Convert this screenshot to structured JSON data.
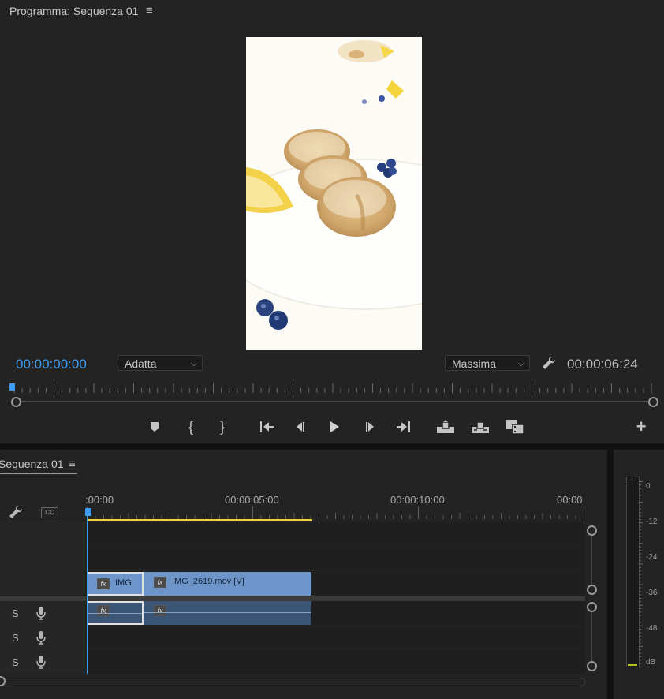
{
  "program": {
    "title": "Programma: Sequenza 01",
    "current_timecode": "00:00:00:00",
    "fit_select": "Adatta",
    "quality_select": "Massima",
    "duration_timecode": "00:00:06:24",
    "playhead_fraction": 0.0
  },
  "transport": {
    "buttons": [
      "add-marker",
      "mark-in",
      "mark-out",
      "go-to-in",
      "step-back",
      "play",
      "step-forward",
      "go-to-out",
      "lift",
      "extract",
      "export-frame",
      "button-editor"
    ]
  },
  "timeline": {
    "title": "Sequenza 01",
    "ruler_labels": [
      ":00:00",
      "00:00:05:00",
      "00:00:10:00",
      "00:00"
    ],
    "video_clips": [
      {
        "label": "IMG",
        "fx": "fx"
      },
      {
        "label": "IMG_2619.mov [V]",
        "fx": "fx"
      }
    ],
    "audio_clip_fx": [
      "fx",
      "fx"
    ],
    "audio_tracks": [
      {
        "solo": "S",
        "mic": "microphone-icon"
      },
      {
        "solo": "S",
        "mic": "microphone-icon"
      },
      {
        "solo": "S",
        "mic": "microphone-icon"
      }
    ],
    "colors": {
      "playhead": "#3d9bf0",
      "work_area": "#e8d43a",
      "video_clip": "#6e95c9",
      "audio_clip": "#3b5577"
    }
  },
  "meters": {
    "scale": [
      "0",
      "-12",
      "-24",
      "-36",
      "-48",
      "dB"
    ]
  }
}
